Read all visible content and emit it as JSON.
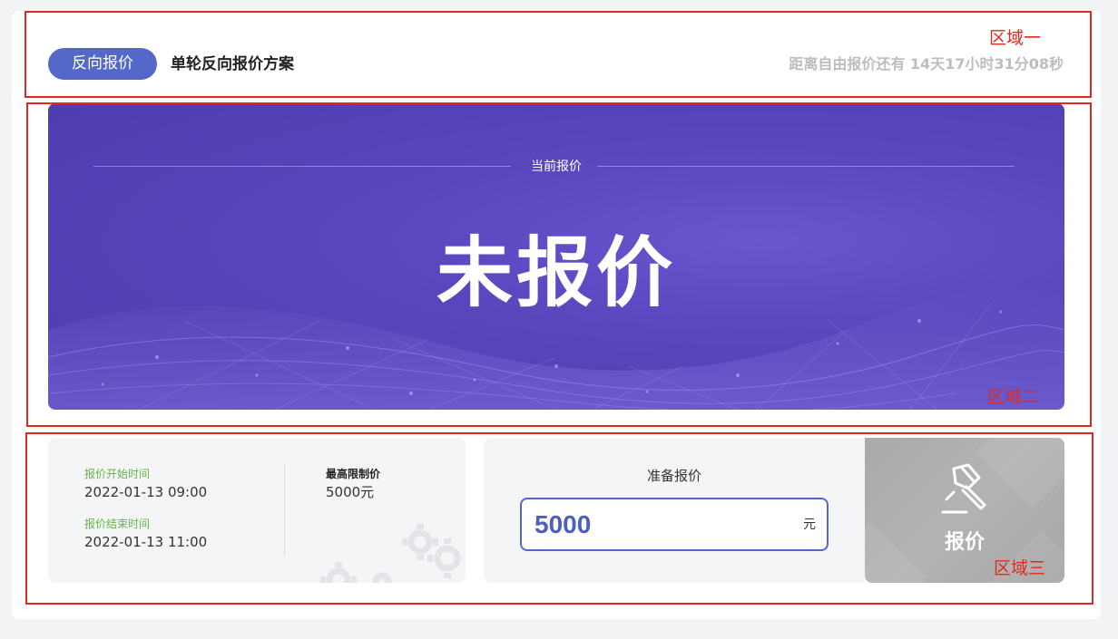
{
  "header": {
    "mode_label": "反向报价",
    "scheme_title": "单轮反向报价方案",
    "countdown": "距离自由报价还有 14天17小时31分08秒"
  },
  "banner": {
    "caption": "当前报价",
    "status": "未报价"
  },
  "info": {
    "start_label": "报价开始时间",
    "start_value": "2022-01-13 09:00",
    "end_label": "报价结束时间",
    "end_value": "2022-01-13 11:00",
    "max_label": "最高限制价",
    "max_value": "5000元"
  },
  "quote": {
    "title": "准备报价",
    "value": "5000",
    "unit": "元"
  },
  "submit": {
    "label": "报价"
  },
  "annotations": {
    "region1": "区域一",
    "region2": "区域二",
    "region3": "区域三"
  },
  "colors": {
    "accent": "#5468c9",
    "banner": "#5846bd",
    "annotation": "#e02a20",
    "green_label": "#67b347",
    "button_disabled": "#aaaaaa"
  }
}
